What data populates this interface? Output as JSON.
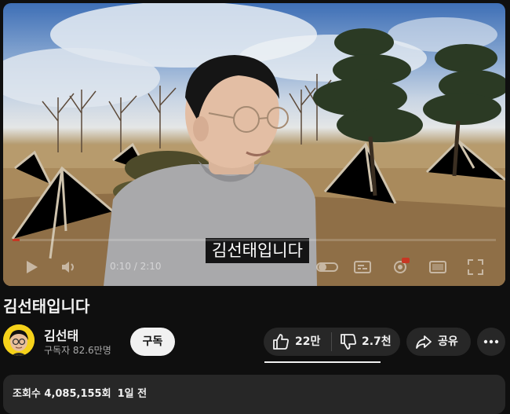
{
  "player": {
    "subtitle": "김선태입니다",
    "time_display": "0:10 / 2:10",
    "progress_fraction": 0.015
  },
  "video": {
    "title": "김선태입니다"
  },
  "channel": {
    "name": "김선태",
    "subscribers": "구독자 82.6만명",
    "subscribe_label": "구독"
  },
  "actions": {
    "likes": "22만",
    "dislikes": "2.7천",
    "share_label": "공유",
    "icons": [
      "thumbs-up-icon",
      "thumbs-down-icon",
      "share-icon",
      "more-icon"
    ]
  },
  "description": {
    "views": "조회수 4,085,155회",
    "date": "1일 전"
  },
  "colors": {
    "background": "#0f0f0f",
    "pill": "#272727",
    "subscribe_bg": "#f1f1f1",
    "progress": "#ff0000",
    "avatar_bg": "#f6d21a"
  }
}
